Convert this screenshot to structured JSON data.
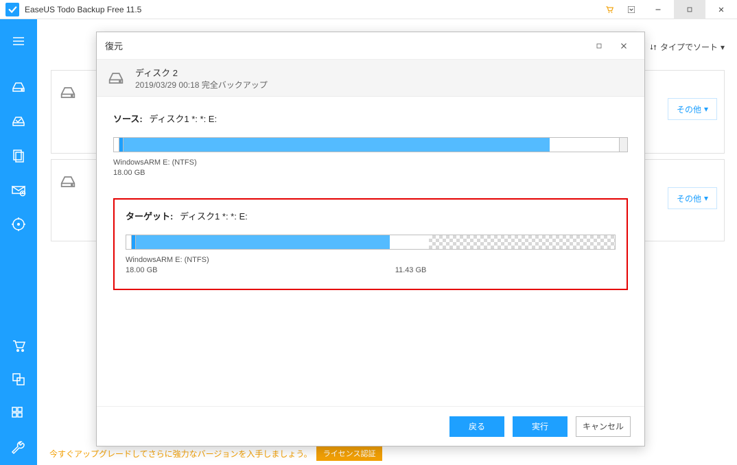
{
  "titlebar": {
    "title": "EaseUS Todo Backup Free 11.5"
  },
  "sort": {
    "label": "タイプでソート"
  },
  "cards": {
    "other": "その他"
  },
  "promo": {
    "text": "今すぐアップグレードしてさらに強力なバージョンを入手しましょう。",
    "button": "ライセンス認証"
  },
  "modal": {
    "title": "復元",
    "disk_name": "ディスク 2",
    "disk_sub": "2019/03/29 00:18 完全バックアップ",
    "source": {
      "k": "ソース:",
      "v": "ディスク1 *: *: E:",
      "part_name": "WindowsARM E: (NTFS)",
      "part_size": "18.00 GB"
    },
    "target": {
      "k": "ターゲット:",
      "v": "ディスク1 *: *: E:",
      "part_name": "WindowsARM E: (NTFS)",
      "part_size": "18.00 GB",
      "free_size": "11.43 GB"
    },
    "buttons": {
      "back": "戻る",
      "run": "実行",
      "cancel": "キャンセル"
    }
  }
}
